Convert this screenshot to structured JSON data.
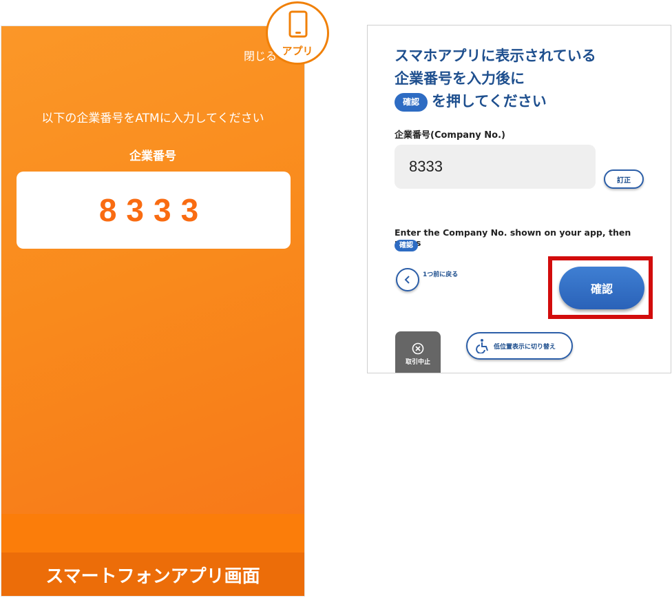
{
  "phone": {
    "close_label": "閉じる",
    "instruction": "以下の企業番号をATMに入力してください",
    "code_label": "企業番号",
    "code_value": "8333",
    "caption": "スマートフォンアプリ画面",
    "badge_label": "アプリ",
    "badge_icon": "smartphone-icon"
  },
  "atm": {
    "title_line1": "スマホアプリに表示されている",
    "title_line2": "企業番号を入力後に",
    "title_chip": "確認",
    "title_line3": "を押してください",
    "field_label": "企業番号(Company No.)",
    "field_value": "8333",
    "correct_label": "訂正",
    "enter_text": "Enter the Company No. shown on your app, then press",
    "enter_chip": "確認",
    "back_label": "1つ前に戻る",
    "confirm_label": "確認",
    "cancel_label": "取引中止",
    "lowpos_label": "低位置表示に切り替え",
    "highlight_color": "#d20c0c",
    "accent_color": "#2e6cc3"
  }
}
